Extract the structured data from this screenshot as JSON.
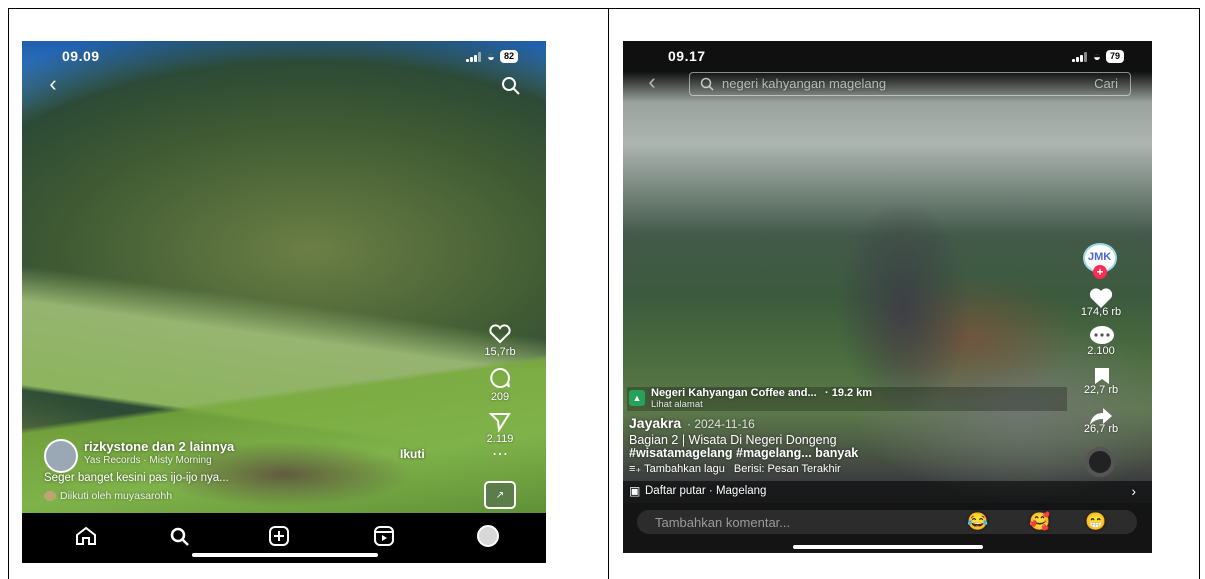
{
  "left_phone": {
    "status_time": "09.09",
    "battery": "82",
    "likes": "15,7rb",
    "comments": "209",
    "shares": "2.119",
    "account": "rizkystone dan 2 lainnya",
    "audio": "Yas Records · Misty Morning",
    "follow": "Ikuti",
    "caption": "Seger banget kesini pas ijo-ijo nya...",
    "followed_by": "Diikuti oleh muyasarohh"
  },
  "right_phone": {
    "status_time": "09.17",
    "battery": "79",
    "search_placeholder": "negeri kahyangan magelang",
    "search_button": "Cari",
    "badge": "JMK",
    "likes": "174,6 rb",
    "comments": "2.100",
    "saves": "22,7 rb",
    "shares": "26,7 rb",
    "location_name": "Negeri Kahyangan Coffee and...",
    "distance": "· 19.2 km",
    "location_sub": "Lihat alamat",
    "author": "Jayakra",
    "date": "· 2024-11-16",
    "caption_line1": "Bagian 2 | Wisata Di Negeri Dongeng",
    "caption_line2": "#wisatamagelang #magelang... banyak",
    "music_prefix": "Tambahkan lagu",
    "music_detail": "Berisi: Pesan Terakhir",
    "playlist": "Daftar putar · Magelang",
    "comment_placeholder": "Tambahkan komentar...",
    "emojis": [
      "😂",
      "🥰",
      "😁"
    ]
  }
}
